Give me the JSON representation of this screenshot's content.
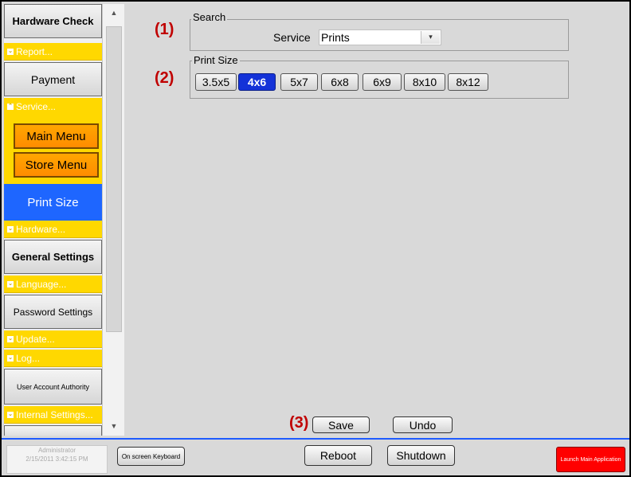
{
  "sidebar": {
    "hardware_check": "Hardware Check",
    "report_cat": "Report...",
    "payment": "Payment",
    "service_cat": "Service...",
    "main_menu": "Main Menu",
    "store_menu": "Store Menu",
    "print_size": "Print Size",
    "hardware_cat": "Hardware...",
    "general_settings": "General Settings",
    "language_cat": "Language...",
    "password_settings": "Password Settings",
    "update_cat": "Update...",
    "log_cat": "Log...",
    "user_account_authority": "User Account Authority",
    "internal_settings_cat": "Internal Settings..."
  },
  "callouts": {
    "c1": "(1)",
    "c2": "(2)",
    "c3": "(3)"
  },
  "search": {
    "title": "Search",
    "service_label": "Service",
    "service_value": "Prints"
  },
  "print_size": {
    "title": "Print Size",
    "options": [
      "3.5x5",
      "4x6",
      "5x7",
      "6x8",
      "6x9",
      "8x10",
      "8x12"
    ],
    "selected": "4x6"
  },
  "actions": {
    "save": "Save",
    "undo": "Undo"
  },
  "bottom": {
    "user_name": "Administrator",
    "timestamp": "2/15/2011 3:42:15 PM",
    "onscreen_keyboard": "On screen Keyboard",
    "reboot": "Reboot",
    "shutdown": "Shutdown",
    "launch": "Launch Main Application"
  },
  "colors": {
    "category_yellow": "#ffd800",
    "selected_blue": "#1e66ff",
    "active_size_blue": "#1432d8",
    "orange_button": "#ff9a00",
    "callout_red": "#c00000",
    "launch_red": "#ff0000",
    "bottom_rule": "#1f5bff"
  }
}
